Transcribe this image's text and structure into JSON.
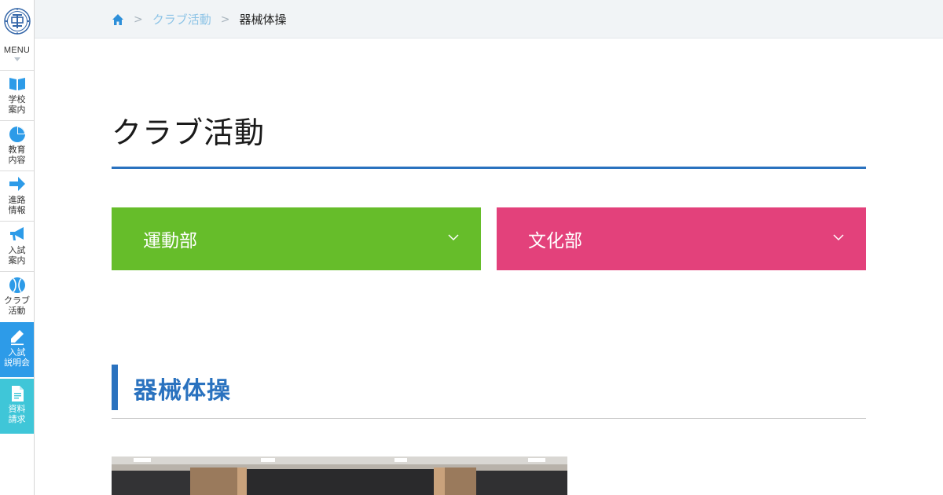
{
  "sidebar": {
    "menu_label": "MENU",
    "items": [
      {
        "label": "学校\n案内",
        "icon": "book-icon"
      },
      {
        "label": "教育\n内容",
        "icon": "pie-chart-icon"
      },
      {
        "label": "進路\n情報",
        "icon": "arrow-right-icon"
      },
      {
        "label": "入試\n案内",
        "icon": "megaphone-icon"
      },
      {
        "label": "クラブ\n活動",
        "icon": "ball-icon"
      },
      {
        "label": "入試\n説明会",
        "icon": "pencil-icon"
      },
      {
        "label": "資料\n請求",
        "icon": "document-icon"
      }
    ]
  },
  "breadcrumb": {
    "separator": ">",
    "items": [
      "クラブ活動",
      "器械体操"
    ]
  },
  "main": {
    "page_title": "クラブ活動",
    "categories": [
      {
        "label": "運動部",
        "color": "#66bd2a"
      },
      {
        "label": "文化部",
        "color": "#e3417b"
      }
    ],
    "section_title": "器械体操"
  },
  "colors": {
    "accent": "#2a72bf",
    "sidebar_highlight_blue": "#2d9be8",
    "sidebar_highlight_cyan": "#3fc6d8"
  }
}
